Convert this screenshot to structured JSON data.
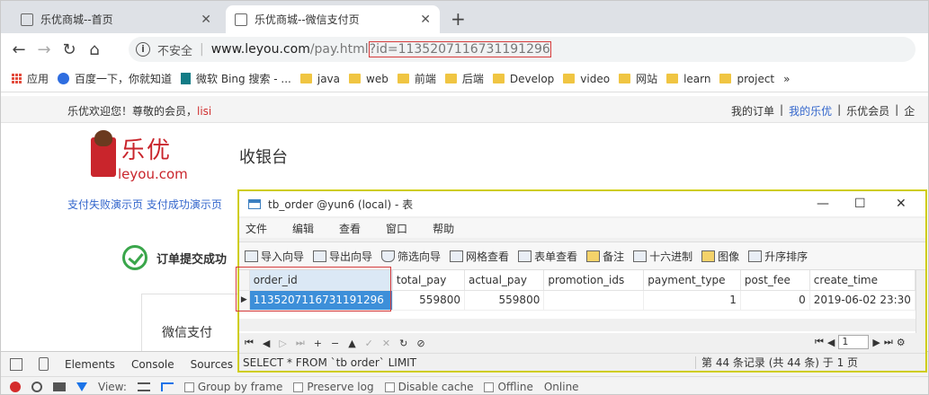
{
  "browser": {
    "tabs": [
      {
        "title": "乐优商城--首页",
        "close": "✕"
      },
      {
        "title": "乐优商城--微信支付页",
        "close": "✕"
      }
    ],
    "new_tab": "+",
    "nav": {
      "back": "←",
      "forward": "→",
      "reload": "↻",
      "home": "⌂"
    },
    "address": {
      "info_glyph": "i",
      "security": "不安全",
      "separator": "|",
      "host": "www.leyou.com",
      "path": "/pay.html",
      "query": "?id=1135207116731191296"
    },
    "bookmarks": [
      {
        "label": "应用",
        "icon": "apps-icon"
      },
      {
        "label": "百度一下，你就知道",
        "icon": "baidu-icon"
      },
      {
        "label": "微软 Bing 搜索 - ...",
        "icon": "bing-icon"
      },
      {
        "label": "java",
        "icon": "folder-icon"
      },
      {
        "label": "web",
        "icon": "folder-icon"
      },
      {
        "label": "前端",
        "icon": "folder-icon"
      },
      {
        "label": "后端",
        "icon": "folder-icon"
      },
      {
        "label": "Develop",
        "icon": "folder-icon"
      },
      {
        "label": "video",
        "icon": "folder-icon"
      },
      {
        "label": "网站",
        "icon": "folder-icon"
      },
      {
        "label": "learn",
        "icon": "folder-icon"
      },
      {
        "label": "project",
        "icon": "folder-icon"
      }
    ],
    "more": "»"
  },
  "site": {
    "welcome": "乐优欢迎您！尊敬的会员，",
    "username": "lisi",
    "top_links": [
      "我的订单",
      "|",
      "我的乐优",
      "|",
      "乐优会员",
      "|",
      "企"
    ],
    "logo_cn": "乐优",
    "logo_en": "leyou.com",
    "cashier": "收银台",
    "demos": "支付失败演示页 支付成功演示页",
    "order_success": "订单提交成功",
    "wechat_pay": "微信支付"
  },
  "navicat": {
    "title": "tb_order @yun6 (local) - 表",
    "window_buttons": {
      "minimize": "—",
      "maximize": "☐",
      "close": "✕"
    },
    "menu": [
      "文件",
      "编辑",
      "查看",
      "窗口",
      "帮助"
    ],
    "tools": [
      {
        "label": "导入向导",
        "icon": "import-icon"
      },
      {
        "label": "导出向导",
        "icon": "export-icon"
      },
      {
        "label": "筛选向导",
        "icon": "filter-icon"
      },
      {
        "label": "网格查看",
        "icon": "grid-view-icon"
      },
      {
        "label": "表单查看",
        "icon": "form-view-icon"
      },
      {
        "label": "备注",
        "icon": "memo-icon"
      },
      {
        "label": "十六进制",
        "icon": "hex-icon"
      },
      {
        "label": "图像",
        "icon": "image-icon"
      },
      {
        "label": "升序排序",
        "icon": "sort-asc-icon"
      }
    ],
    "columns": [
      "order_id",
      "total_pay",
      "actual_pay",
      "promotion_ids",
      "payment_type",
      "post_fee",
      "create_time"
    ],
    "rows": [
      [
        "1135207116731191296",
        "559800",
        "559800",
        "",
        "1",
        "0",
        "2019-06-02 23:30"
      ]
    ],
    "row_marker": "▶",
    "nav_buttons": [
      "⏮",
      "◀",
      "▷",
      "⏭",
      "+",
      "−",
      "▲",
      "✓",
      "✕",
      "↻",
      "⊘"
    ],
    "page_nav": {
      "first": "⏮",
      "prev": "◀",
      "page": "1",
      "next": "▶",
      "last": "⏭",
      "settings": "⚙"
    },
    "sql": "SELECT * FROM `tb order` LIMIT",
    "record_status": "第 44 条记录 (共 44 条) 于 1 页"
  },
  "devtools": {
    "tabs": [
      "Elements",
      "Console",
      "Sources"
    ],
    "view_label": "View:",
    "options": [
      "Group by frame",
      "Preserve log",
      "Disable cache",
      "Offline",
      "Online"
    ]
  }
}
